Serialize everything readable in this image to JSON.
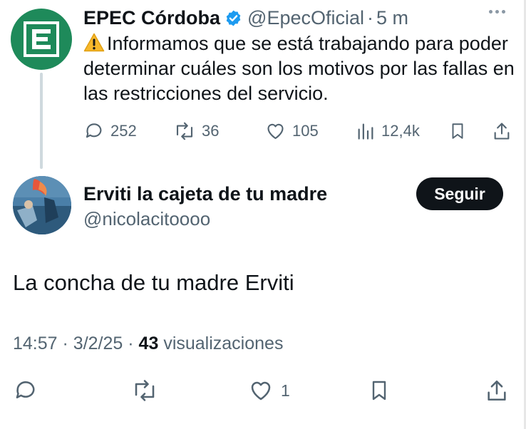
{
  "parent_tweet": {
    "name": "EPEC Córdoba",
    "handle": "@EpecOficial",
    "separator": "·",
    "time_ago": "5 m",
    "avatar_icon": "epec-logo-icon",
    "text": "Informamos que se está trabajando para poder determinar cuáles son los motivos por las fallas en las restricciones del servicio.",
    "stats": {
      "replies": "252",
      "reposts": "36",
      "likes": "105",
      "views": "12,4k"
    }
  },
  "reply_tweet": {
    "name": "Erviti la cajeta de tu madre",
    "handle": "@nicolacitoooo",
    "follow_label": "Seguir",
    "text": "La concha de tu madre Erviti",
    "time": "14:57",
    "date": "3/2/25",
    "separator": "·",
    "views_count": "43",
    "views_label": "visualizaciones",
    "stats": {
      "likes": "1"
    }
  },
  "colors": {
    "text": "#0f1419",
    "muted": "#536471",
    "verified": "#1d9bf0",
    "epec_green": "#1e8a5a",
    "follow_bg": "#0f1419"
  }
}
